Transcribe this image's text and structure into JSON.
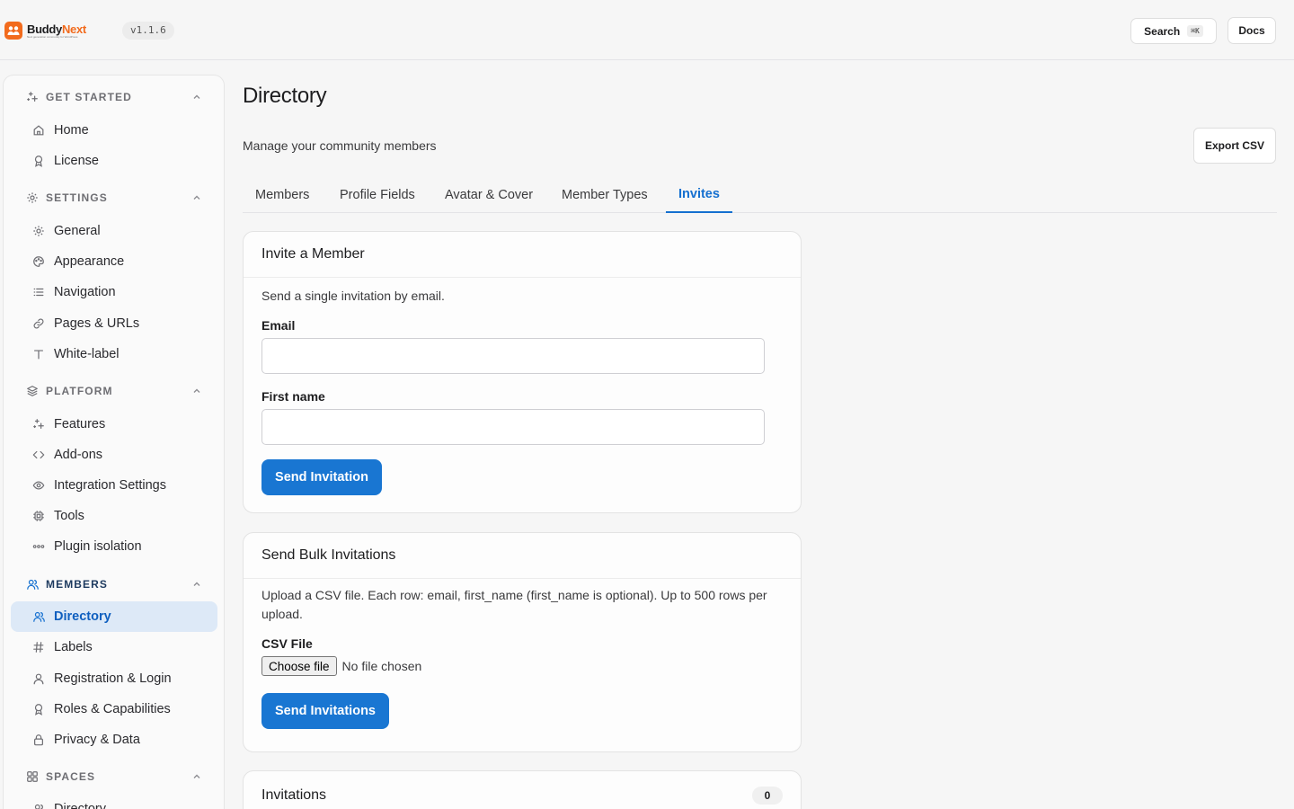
{
  "app": {
    "name_part1": "Buddy",
    "name_part2": "Next",
    "tagline": "Next generation community for WordPress",
    "version": "v1.1.6"
  },
  "topbar": {
    "search_label": "Search",
    "search_shortcut": "⌘K",
    "docs_label": "Docs"
  },
  "sidebar": {
    "get_started": {
      "title": "GET STARTED",
      "icon": "sparkles-icon",
      "items": [
        {
          "label": "Home",
          "icon": "home-icon"
        },
        {
          "label": "License",
          "icon": "badge-icon"
        }
      ]
    },
    "settings": {
      "title": "SETTINGS",
      "icon": "gear-icon",
      "items": [
        {
          "label": "General",
          "icon": "gear-icon"
        },
        {
          "label": "Appearance",
          "icon": "palette-icon"
        },
        {
          "label": "Navigation",
          "icon": "list-icon"
        },
        {
          "label": "Pages & URLs",
          "icon": "link-icon"
        },
        {
          "label": "White-label",
          "icon": "type-icon"
        }
      ]
    },
    "platform": {
      "title": "PLATFORM",
      "icon": "layers-icon",
      "items": [
        {
          "label": "Features",
          "icon": "sparkles-icon"
        },
        {
          "label": "Add-ons",
          "icon": "code-icon"
        },
        {
          "label": "Integration Settings",
          "icon": "eye-icon"
        },
        {
          "label": "Tools",
          "icon": "cpu-icon"
        },
        {
          "label": "Plugin isolation",
          "icon": "dots-icon"
        }
      ]
    },
    "members": {
      "title": "MEMBERS",
      "icon": "users-icon",
      "items": [
        {
          "label": "Directory",
          "icon": "users-icon"
        },
        {
          "label": "Labels",
          "icon": "hash-icon"
        },
        {
          "label": "Registration & Login",
          "icon": "user-icon"
        },
        {
          "label": "Roles & Capabilities",
          "icon": "badge-icon"
        },
        {
          "label": "Privacy & Data",
          "icon": "lock-icon"
        }
      ]
    },
    "spaces": {
      "title": "SPACES",
      "icon": "grid-icon",
      "items": [
        {
          "label": "Directory",
          "icon": "users-icon"
        }
      ]
    }
  },
  "main": {
    "title": "Directory",
    "subtitle": "Manage your community members",
    "export_label": "Export CSV",
    "tabs": [
      "Members",
      "Profile Fields",
      "Avatar & Cover",
      "Member Types",
      "Invites"
    ],
    "active_tab": "Invites",
    "invite_card": {
      "title": "Invite a Member",
      "description": "Send a single invitation by email.",
      "email_label": "Email",
      "email_value": "",
      "first_name_label": "First name",
      "first_name_value": "",
      "submit_label": "Send Invitation"
    },
    "bulk_card": {
      "title": "Send Bulk Invitations",
      "description": "Upload a CSV file. Each row: email, first_name (first_name is optional). Up to 500 rows per upload.",
      "file_label": "CSV File",
      "file_button": "Choose file",
      "file_status": "No file chosen",
      "submit_label": "Send Invitations"
    },
    "invitations_card": {
      "title": "Invitations",
      "count": "0"
    }
  },
  "colors": {
    "accent": "#1976d2",
    "brand": "#f26b1d",
    "active_nav_bg": "#dde9f7"
  }
}
